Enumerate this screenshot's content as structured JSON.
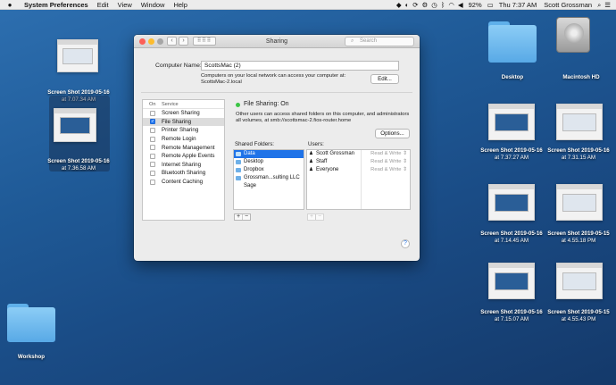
{
  "menubar": {
    "apple": "",
    "app_name": "System Preferences",
    "menus": [
      "Edit",
      "View",
      "Window",
      "Help"
    ],
    "battery": "92%",
    "clock": "Thu 7:37 AM",
    "user": "Scott Grossman"
  },
  "window": {
    "title": "Sharing",
    "search_placeholder": "Search",
    "computer_name_label": "Computer Name:",
    "computer_name_value": "ScottsMac (2)",
    "computer_name_note_1": "Computers on your local network can access your computer at:",
    "computer_name_note_2": "ScottsMac-2.local",
    "edit_button": "Edit...",
    "service_header_on": "On",
    "service_header_service": "Service",
    "services": [
      {
        "label": "Screen Sharing",
        "on": false,
        "selected": false
      },
      {
        "label": "File Sharing",
        "on": true,
        "selected": true
      },
      {
        "label": "Printer Sharing",
        "on": false,
        "selected": false
      },
      {
        "label": "Remote Login",
        "on": false,
        "selected": false
      },
      {
        "label": "Remote Management",
        "on": false,
        "selected": false
      },
      {
        "label": "Remote Apple Events",
        "on": false,
        "selected": false
      },
      {
        "label": "Internet Sharing",
        "on": false,
        "selected": false
      },
      {
        "label": "Bluetooth Sharing",
        "on": false,
        "selected": false
      },
      {
        "label": "Content Caching",
        "on": false,
        "selected": false
      }
    ],
    "status": "File Sharing: On",
    "status_desc_1": "Other users can access shared folders on this computer, and administrators",
    "status_desc_2": "all volumes, at smb://scottsmac-2.fios-router.home",
    "options_button": "Options...",
    "shared_folders_label": "Shared Folders:",
    "shared_folders": [
      "Data",
      "Desktop",
      "Dropbox",
      "Grossman...sulting LLC",
      "Sage"
    ],
    "users_label": "Users:",
    "users": [
      {
        "name": "Scott Grossman",
        "perm": "Read & Write"
      },
      {
        "name": "Staff",
        "perm": "Read & Write"
      },
      {
        "name": "Everyone",
        "perm": "Read & Write"
      }
    ],
    "plus": "+",
    "minus": "−",
    "help": "?"
  },
  "desktop": {
    "left_icons": [
      {
        "line1": "Screen Shot 2019-05-16",
        "line2": "at 7.07.34 AM"
      },
      {
        "line1": "Screen Shot 2019-05-16",
        "line2": "at 7.36.58 AM"
      }
    ],
    "folder_desktop": "Desktop",
    "hdd": "Macintosh HD",
    "workshop": "Workshop",
    "right_icons": [
      {
        "line1": "Screen Shot 2019-05-16",
        "line2": "at 7.37.27 AM"
      },
      {
        "line1": "Screen Shot 2019-05-16",
        "line2": "at 7.31.15 AM"
      },
      {
        "line1": "Screen Shot 2019-05-16",
        "line2": "at 7.14.45 AM"
      },
      {
        "line1": "Screen Shot 2019-05-15",
        "line2": "at 4.55.18 PM"
      },
      {
        "line1": "Screen Shot 2019-05-16",
        "line2": "at 7.15.07 AM"
      },
      {
        "line1": "Screen Shot 2019-05-15",
        "line2": "at 4.55.43 PM"
      }
    ]
  }
}
